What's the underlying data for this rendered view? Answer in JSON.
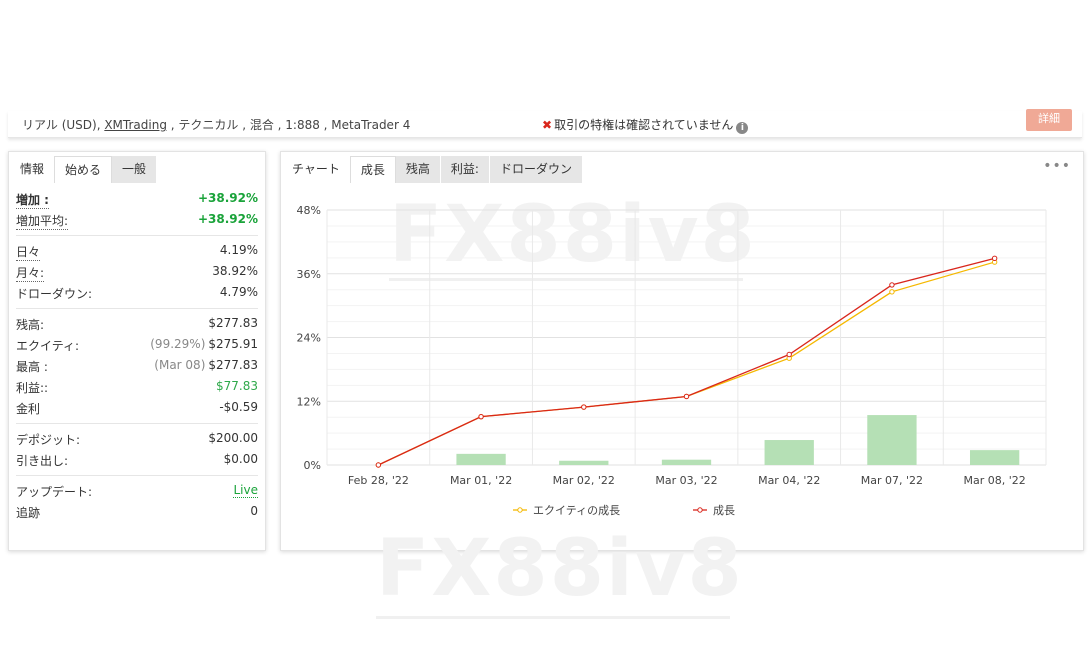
{
  "topbar": {
    "account_prefix": "リアル (USD), ",
    "broker": "XMTrading",
    "account_suffix": " , テクニカル , 混合 , 1:888 , MetaTrader 4",
    "verify_text": "取引の特権は確認されていません",
    "detail_button": "詳細"
  },
  "left_tabs": [
    "情報",
    "始める",
    "一般"
  ],
  "stats": {
    "gain_label": "増加 :",
    "gain_value": "+38.92%",
    "abs_gain_label": "増加平均:",
    "abs_gain_value": "+38.92%",
    "daily_label": "日々",
    "daily_value": "4.19%",
    "monthly_label": "月々:",
    "monthly_value": "38.92%",
    "drawdown_label": "ドローダウン:",
    "drawdown_value": "4.79%",
    "balance_label": "残高:",
    "balance_value": "$277.83",
    "equity_label": "エクイティ:",
    "equity_pct": "(99.29%)",
    "equity_value": "$275.91",
    "high_label": "最高 :",
    "high_date": "(Mar 08)",
    "high_value": "$277.83",
    "profit_label": "利益::",
    "profit_value": "$77.83",
    "interest_label": "金利",
    "interest_value": "-$0.59",
    "deposit_label": "デポジット:",
    "deposit_value": "$200.00",
    "withdraw_label": "引き出し:",
    "withdraw_value": "$0.00",
    "update_label": "アップデート:",
    "update_value": "Live",
    "track_label": "追跡",
    "track_value": "0"
  },
  "right_tabs": [
    "チャート",
    "成長",
    "残高",
    "利益:",
    "ドローダウン"
  ],
  "watermark": "FX88iv8",
  "colors": {
    "equity": "#f5b800",
    "growth": "#d9261c",
    "bars": "#b5e0b5",
    "positive": "#1aa33a"
  },
  "chart_data": {
    "type": "line",
    "categories": [
      "Feb 28, '22",
      "Mar 01, '22",
      "Mar 02, '22",
      "Mar 03, '22",
      "Mar 04, '22",
      "Mar 07, '22",
      "Mar 08, '22"
    ],
    "ylim": [
      0,
      48
    ],
    "yticks": [
      "0%",
      "12%",
      "24%",
      "36%",
      "48%"
    ],
    "series": [
      {
        "name": "エクイティの成長",
        "values": [
          0,
          9.1,
          10.9,
          12.9,
          20.1,
          32.6,
          38.2
        ]
      },
      {
        "name": "成長",
        "values": [
          0,
          9.1,
          10.9,
          12.9,
          20.8,
          33.9,
          38.9
        ]
      }
    ],
    "bars": [
      0,
      2.1,
      0.8,
      1.0,
      4.7,
      9.4,
      2.8
    ],
    "legend_position": "bottom"
  }
}
